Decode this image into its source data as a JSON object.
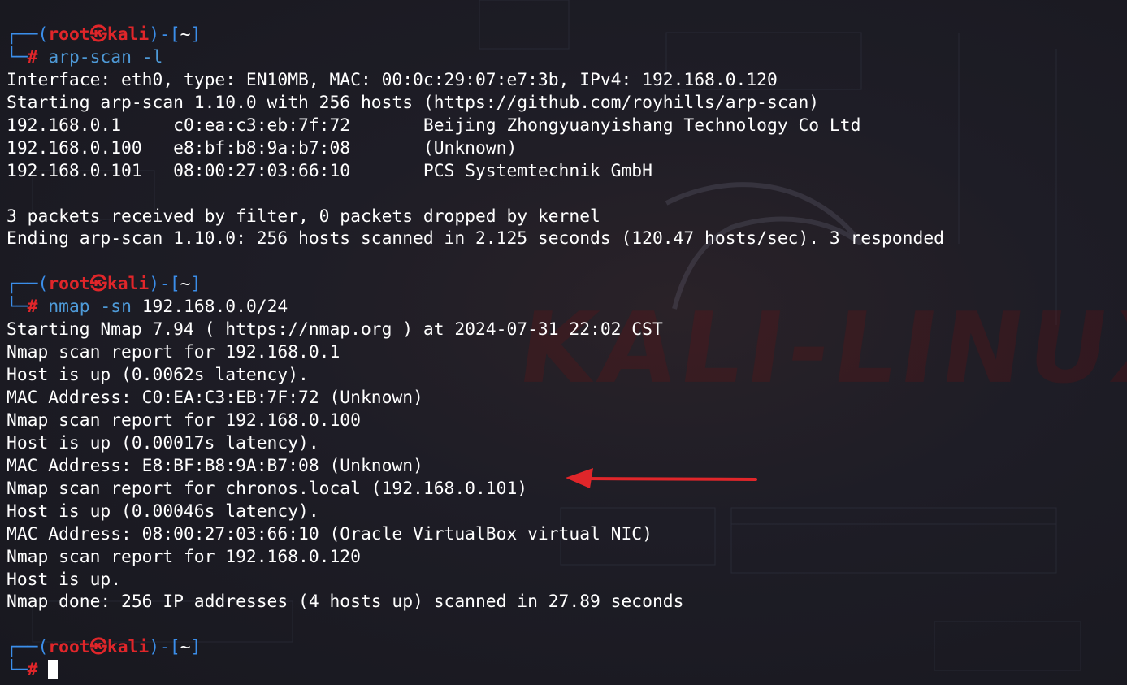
{
  "prompt": {
    "open": "┌──(",
    "user": "root",
    "at": "㉿",
    "host": "kali",
    "mid": ")-[",
    "dir": "~",
    "close": "]",
    "corner": "└─",
    "symbol": "#"
  },
  "blocks": [
    {
      "command": {
        "name": "arp-scan",
        "args": " -l",
        "target": ""
      },
      "output": [
        "Interface: eth0, type: EN10MB, MAC: 00:0c:29:07:e7:3b, IPv4: 192.168.0.120",
        "Starting arp-scan 1.10.0 with 256 hosts (https://github.com/royhills/arp-scan)",
        "192.168.0.1     c0:ea:c3:eb:7f:72       Beijing Zhongyuanyishang Technology Co Ltd",
        "192.168.0.100   e8:bf:b8:9a:b7:08       (Unknown)",
        "192.168.0.101   08:00:27:03:66:10       PCS Systemtechnik GmbH",
        "",
        "3 packets received by filter, 0 packets dropped by kernel",
        "Ending arp-scan 1.10.0: 256 hosts scanned in 2.125 seconds (120.47 hosts/sec). 3 responded",
        ""
      ]
    },
    {
      "command": {
        "name": "nmap",
        "args": " -sn",
        "target": " 192.168.0.0/24"
      },
      "output": [
        "Starting Nmap 7.94 ( https://nmap.org ) at 2024-07-31 22:02 CST",
        "Nmap scan report for 192.168.0.1",
        "Host is up (0.0062s latency).",
        "MAC Address: C0:EA:C3:EB:7F:72 (Unknown)",
        "Nmap scan report for 192.168.0.100",
        "Host is up (0.00017s latency).",
        "MAC Address: E8:BF:B8:9A:B7:08 (Unknown)",
        "Nmap scan report for chronos.local (192.168.0.101)",
        "Host is up (0.00046s latency).",
        "MAC Address: 08:00:27:03:66:10 (Oracle VirtualBox virtual NIC)",
        "Nmap scan report for 192.168.0.120",
        "Host is up.",
        "Nmap done: 256 IP addresses (4 hosts up) scanned in 27.89 seconds",
        ""
      ]
    }
  ],
  "colors": {
    "prompt_frame": "#3b8eea",
    "prompt_user": "#e0262a",
    "command": "#4e9ad8",
    "text": "#ffffff",
    "arrow": "#e0262a",
    "background": "#1c1c25"
  },
  "icons": {
    "skull_symbol": "kali-skull-icon",
    "arrow": "red-arrow-annotation"
  }
}
